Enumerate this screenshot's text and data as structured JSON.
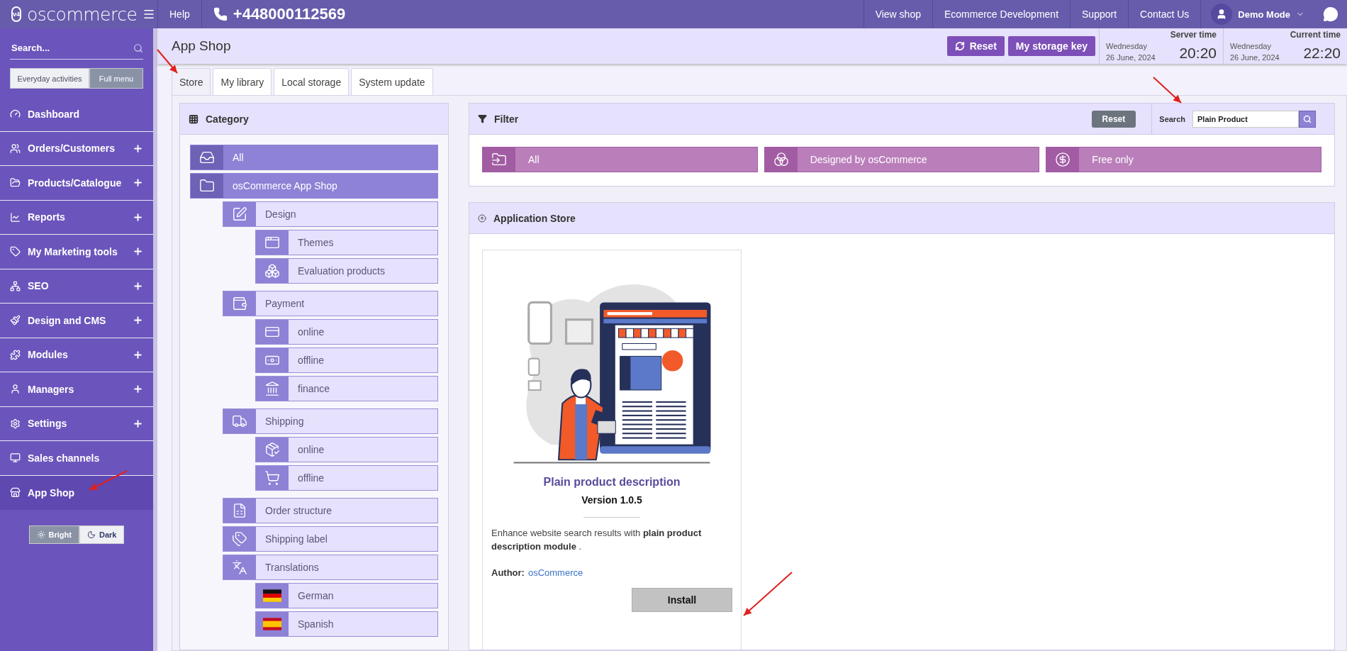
{
  "topbar": {
    "logo": "oscommerce",
    "logo_badge": "v4",
    "help": "Help",
    "phone": "+448000112569",
    "links": [
      "View shop",
      "Ecommerce Development",
      "Support",
      "Contact Us"
    ],
    "user": "Demo Mode"
  },
  "sidebar": {
    "search_placeholder": "Search...",
    "modes": [
      {
        "label": "Everyday activities",
        "selected": false
      },
      {
        "label": "Full menu",
        "selected": true
      }
    ],
    "items": [
      {
        "label": "Dashboard",
        "expandable": false,
        "selected": false
      },
      {
        "label": "Orders/Customers",
        "expandable": true,
        "selected": false
      },
      {
        "label": "Products/Catalogue",
        "expandable": true,
        "selected": false
      },
      {
        "label": "Reports",
        "expandable": true,
        "selected": false
      },
      {
        "label": "My Marketing tools",
        "expandable": true,
        "selected": false
      },
      {
        "label": "SEO",
        "expandable": true,
        "selected": false
      },
      {
        "label": "Design and CMS",
        "expandable": true,
        "selected": false
      },
      {
        "label": "Modules",
        "expandable": true,
        "selected": false
      },
      {
        "label": "Managers",
        "expandable": true,
        "selected": false
      },
      {
        "label": "Settings",
        "expandable": true,
        "selected": false
      },
      {
        "label": "Sales channels",
        "expandable": false,
        "selected": false
      },
      {
        "label": "App Shop",
        "expandable": false,
        "selected": true
      }
    ],
    "themes": [
      {
        "label": "Bright",
        "selected": true
      },
      {
        "label": "Dark",
        "selected": false
      }
    ]
  },
  "header": {
    "title": "App Shop",
    "buttons": [
      "Reset",
      "My storage key"
    ],
    "clocks": [
      {
        "label": "Server time",
        "day": "Wednesday",
        "date": "26 June, 2024",
        "time": "20:20"
      },
      {
        "label": "Current time",
        "day": "Wednesday",
        "date": "26 June, 2024",
        "time": "22:20"
      }
    ]
  },
  "tabs": [
    {
      "label": "Store",
      "selected": true
    },
    {
      "label": "My library",
      "selected": false
    },
    {
      "label": "Local storage",
      "selected": false
    },
    {
      "label": "System update",
      "selected": false
    }
  ],
  "category": {
    "title": "Category",
    "tree": [
      {
        "label": "All"
      },
      {
        "label": "osCommerce App Shop",
        "children": [
          {
            "label": "Design",
            "children": [
              {
                "label": "Themes"
              },
              {
                "label": "Evaluation products"
              }
            ]
          },
          {
            "label": "Payment",
            "children": [
              {
                "label": "online"
              },
              {
                "label": "offline"
              },
              {
                "label": "finance"
              }
            ]
          },
          {
            "label": "Shipping",
            "children": [
              {
                "label": "online"
              },
              {
                "label": "offline"
              }
            ]
          },
          {
            "label": "Order structure"
          },
          {
            "label": "Shipping label"
          },
          {
            "label": "Translations",
            "children": [
              {
                "label": "German"
              },
              {
                "label": "Spanish"
              }
            ]
          }
        ]
      }
    ]
  },
  "filter": {
    "title": "Filter",
    "reset": "Reset",
    "search_label": "Search",
    "search_value": "Plain Product",
    "options": [
      "All",
      "Designed by osCommerce",
      "Free only"
    ]
  },
  "store": {
    "title": "Application Store",
    "apps": [
      {
        "name": "Plain product description",
        "version": "Version 1.0.5",
        "description": "Enhance website search results with **plain product description module** .",
        "author_label": "Author:",
        "author": "osCommerce",
        "action": "Install"
      }
    ]
  }
}
